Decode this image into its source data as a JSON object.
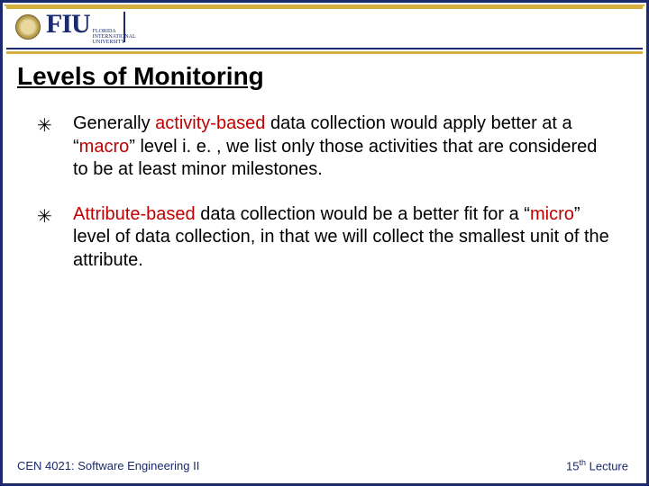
{
  "header": {
    "logo_main": "FIU",
    "logo_sub": "FLORIDA INTERNATIONAL UNIVERSITY"
  },
  "title": "Levels of Monitoring",
  "bullets": [
    {
      "pre": "Generally ",
      "kw1": "activity-based",
      "mid1": " data collection would apply better at a “",
      "kw2": "macro",
      "post": "” level i. e. , we list only those activities that are considered to be at least minor milestones."
    },
    {
      "pre": "",
      "kw1": "Attribute-based",
      "mid1": " data collection would be a better fit for a “",
      "kw2": "micro",
      "post": "” level of data collection, in that we will collect the smallest unit of the attribute."
    }
  ],
  "footer": {
    "left": "CEN 4021: Software Engineering II",
    "right_num": "15",
    "right_sup": "th",
    "right_word": " Lecture"
  }
}
